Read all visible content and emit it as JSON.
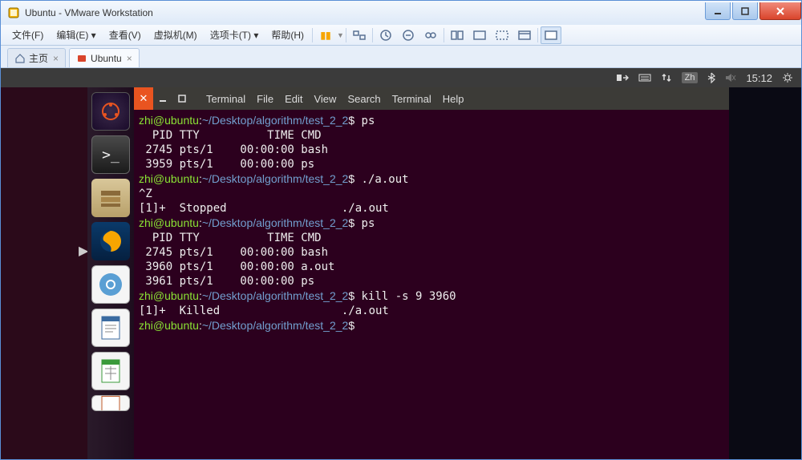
{
  "window": {
    "title": "Ubuntu - VMware Workstation"
  },
  "menubar": {
    "file": "文件(F)",
    "edit": "编辑(E)",
    "view": "查看(V)",
    "vm": "虚拟机(M)",
    "tabs": "选项卡(T)",
    "help": "帮助(H)"
  },
  "tabs": {
    "home": "主页",
    "vm_name": "Ubuntu"
  },
  "panel": {
    "zh": "Zh",
    "time": "15:12"
  },
  "terminal": {
    "menus": {
      "terminal1": "Terminal",
      "file": "File",
      "edit": "Edit",
      "view": "View",
      "search": "Search",
      "terminal2": "Terminal",
      "help": "Help"
    },
    "prompt": {
      "user": "zhi@ubuntu",
      "path": "~/Desktop/algorithm/test_2_2",
      "dollar": "$"
    },
    "lines": [
      {
        "type": "cmd",
        "text": "ps"
      },
      {
        "type": "out",
        "text": "  PID TTY          TIME CMD"
      },
      {
        "type": "out",
        "text": " 2745 pts/1    00:00:00 bash"
      },
      {
        "type": "out",
        "text": " 3959 pts/1    00:00:00 ps"
      },
      {
        "type": "cmd",
        "text": "./a.out"
      },
      {
        "type": "out",
        "text": "^Z"
      },
      {
        "type": "out",
        "text": "[1]+  Stopped                 ./a.out"
      },
      {
        "type": "cmd",
        "text": "ps"
      },
      {
        "type": "out",
        "text": "  PID TTY          TIME CMD"
      },
      {
        "type": "out",
        "text": " 2745 pts/1    00:00:00 bash"
      },
      {
        "type": "out",
        "text": " 3960 pts/1    00:00:00 a.out"
      },
      {
        "type": "out",
        "text": " 3961 pts/1    00:00:00 ps"
      },
      {
        "type": "cmd",
        "text": "kill -s 9 3960"
      },
      {
        "type": "out",
        "text": "[1]+  Killed                  ./a.out"
      },
      {
        "type": "cmd",
        "text": ""
      }
    ]
  }
}
